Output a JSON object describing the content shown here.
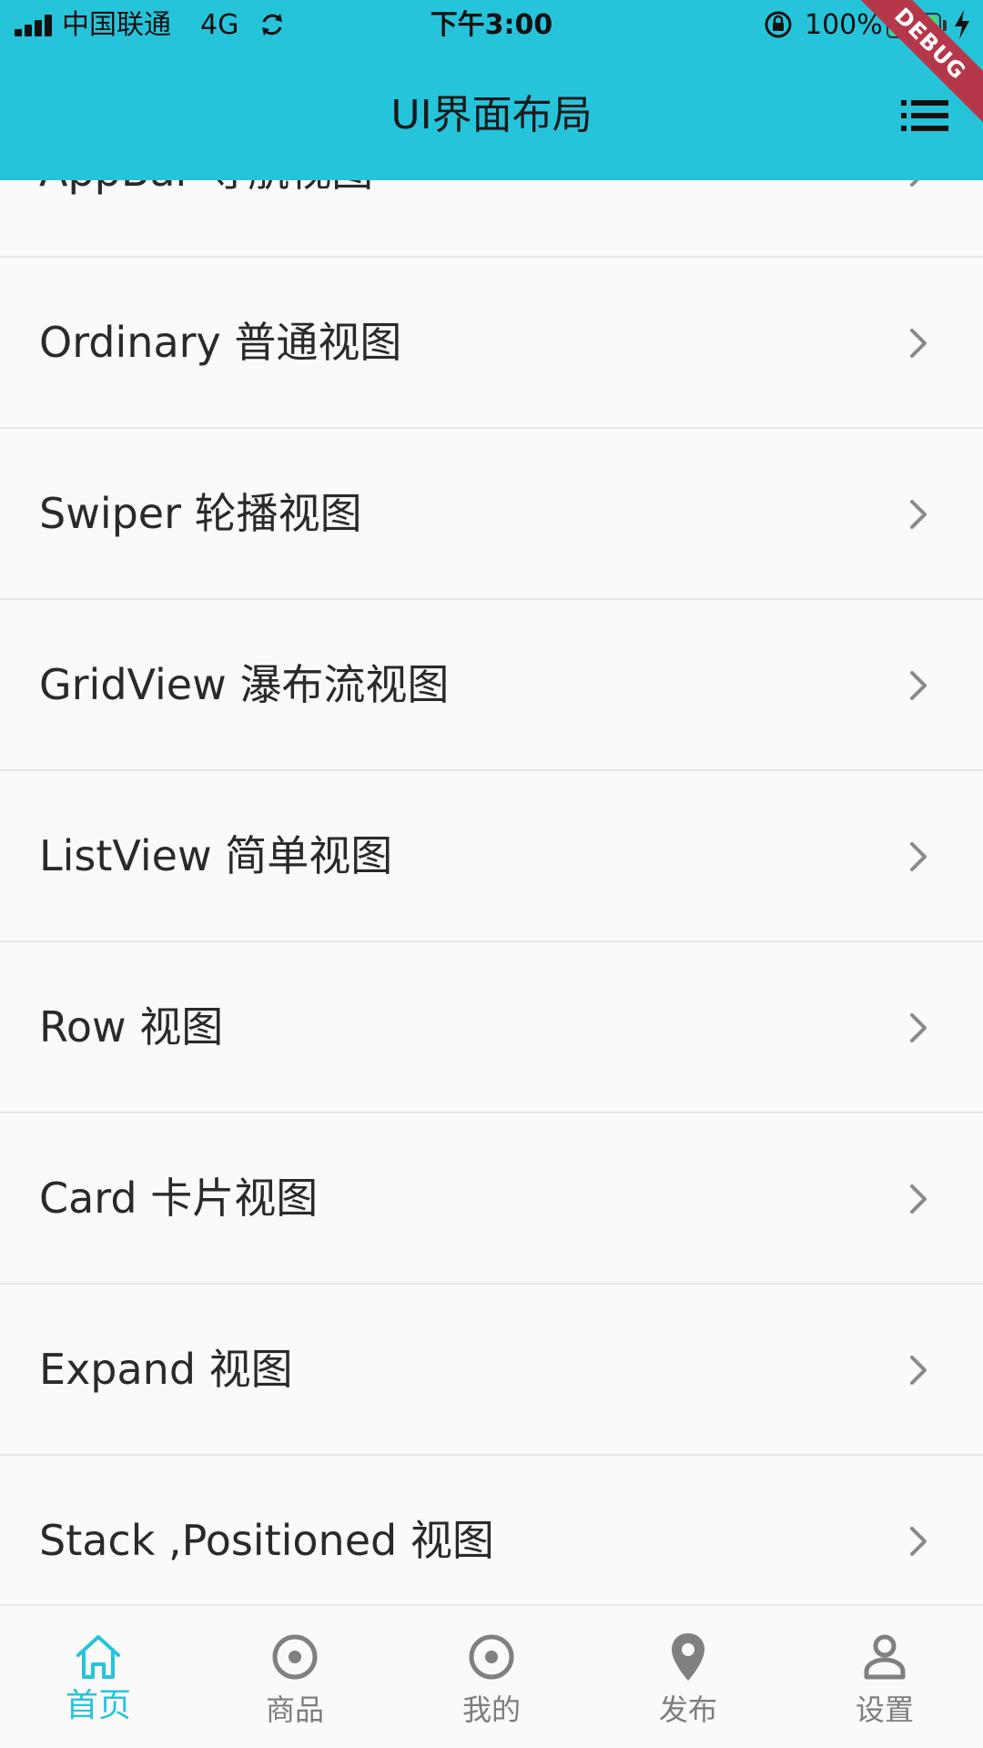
{
  "status_bar": {
    "carrier": "中国联通",
    "network": "4G",
    "time": "下午3:00",
    "battery": "100%"
  },
  "app_bar": {
    "title": "UI界面布局",
    "menu_icon": "list-menu-icon",
    "debug_banner": "DEBUG"
  },
  "list": {
    "items": [
      {
        "label": "AppBar 导航视图"
      },
      {
        "label": "Ordinary 普通视图"
      },
      {
        "label": "Swiper 轮播视图"
      },
      {
        "label": "GridView 瀑布流视图"
      },
      {
        "label": "ListView 简单视图"
      },
      {
        "label": "Row 视图"
      },
      {
        "label": "Card 卡片视图"
      },
      {
        "label": "Expand 视图"
      },
      {
        "label": "Stack ,Positioned 视图"
      }
    ],
    "chevron_icon": "chevron-right-icon"
  },
  "bottom_nav": {
    "items": [
      {
        "label": "首页",
        "icon": "home-icon",
        "active": true
      },
      {
        "label": "商品",
        "icon": "radio-circle-icon",
        "active": false
      },
      {
        "label": "我的",
        "icon": "radio-circle-icon",
        "active": false
      },
      {
        "label": "发布",
        "icon": "location-pin-icon",
        "active": false
      },
      {
        "label": "设置",
        "icon": "person-icon",
        "active": false
      }
    ]
  },
  "colors": {
    "app_bar": "#26c4da",
    "active_tab": "#26c4da",
    "inactive_tab": "#7d7d7d",
    "list_bg": "#fafafa",
    "debug_banner": "#b7374a",
    "battery": "#4cd964"
  }
}
